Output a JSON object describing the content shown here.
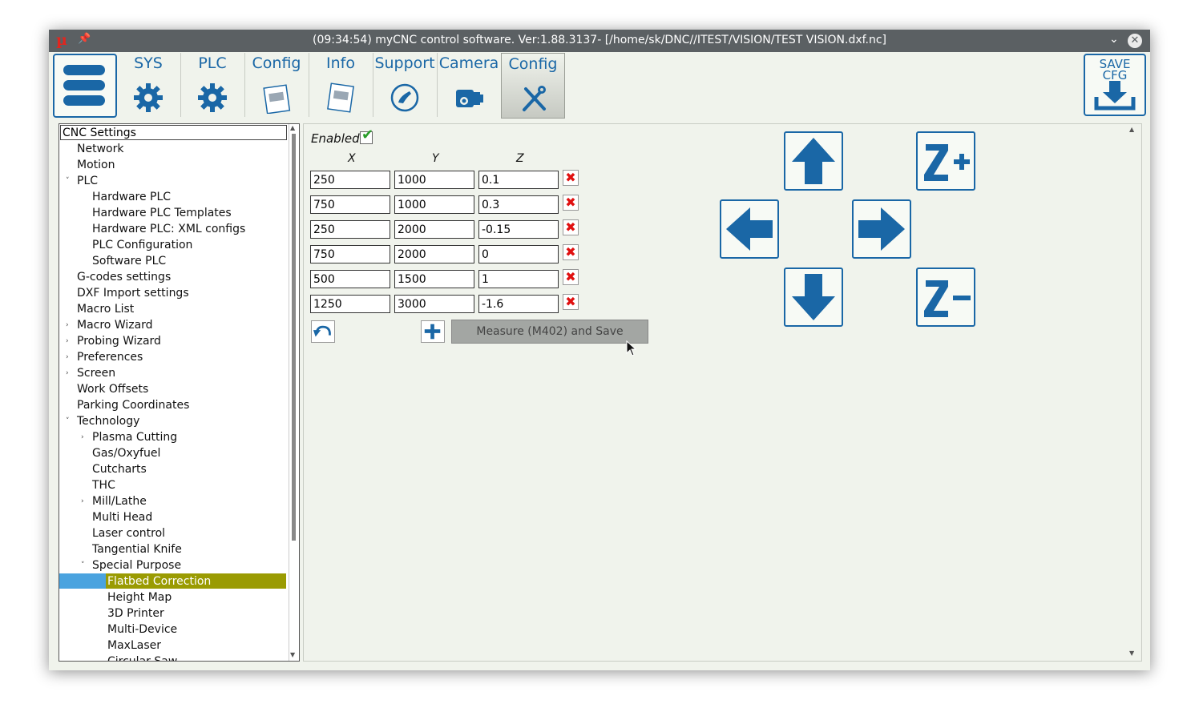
{
  "titlebar": {
    "logo": "µ",
    "pin": "📌",
    "title": "(09:34:54) myCNC control software. Ver:1.88.3137- [/home/sk/DNC//ITEST/VISION/TEST VISION.dxf.nc]",
    "minimize": "⌄",
    "close": "✕"
  },
  "tabs": [
    {
      "label": "SYS",
      "icon": "gear-icon"
    },
    {
      "label": "PLC",
      "icon": "gear-icon"
    },
    {
      "label": "Config",
      "icon": "document-icon"
    },
    {
      "label": "Info",
      "icon": "document-icon"
    },
    {
      "label": "Support",
      "icon": "phone-icon"
    },
    {
      "label": "Camera",
      "icon": "camera-icon"
    },
    {
      "label": "Config",
      "icon": "tools-icon",
      "active": true
    }
  ],
  "save_cfg": {
    "line1": "SAVE",
    "line2": "CFG"
  },
  "tree": {
    "header": "CNC Settings",
    "items": [
      {
        "label": "Network",
        "level": 1
      },
      {
        "label": "Motion",
        "level": 1
      },
      {
        "label": "PLC",
        "level": 1,
        "arrow": "˅"
      },
      {
        "label": "Hardware PLC",
        "level": 2
      },
      {
        "label": "Hardware PLC Templates",
        "level": 2
      },
      {
        "label": "Hardware PLC: XML configs",
        "level": 2
      },
      {
        "label": "PLC Configuration",
        "level": 2
      },
      {
        "label": "Software PLC",
        "level": 2
      },
      {
        "label": "G-codes settings",
        "level": 1
      },
      {
        "label": "DXF Import settings",
        "level": 1
      },
      {
        "label": "Macro List",
        "level": 1
      },
      {
        "label": "Macro Wizard",
        "level": 1,
        "arrow": "›"
      },
      {
        "label": "Probing Wizard",
        "level": 1,
        "arrow": "›"
      },
      {
        "label": "Preferences",
        "level": 1,
        "arrow": "›"
      },
      {
        "label": "Screen",
        "level": 1,
        "arrow": "›"
      },
      {
        "label": "Work Offsets",
        "level": 1
      },
      {
        "label": "Parking Coordinates",
        "level": 1
      },
      {
        "label": "Technology",
        "level": 1,
        "arrow": "˅"
      },
      {
        "label": "Plasma Cutting",
        "level": 2,
        "arrow": "›"
      },
      {
        "label": "Gas/Oxyfuel",
        "level": 2
      },
      {
        "label": "Cutcharts",
        "level": 2
      },
      {
        "label": "THC",
        "level": 2
      },
      {
        "label": "Mill/Lathe",
        "level": 2,
        "arrow": "›"
      },
      {
        "label": "Multi Head",
        "level": 2
      },
      {
        "label": "Laser control",
        "level": 2
      },
      {
        "label": "Tangential Knife",
        "level": 2
      },
      {
        "label": "Special Purpose",
        "level": 2,
        "arrow": "˅"
      },
      {
        "label": "Flatbed Correction",
        "level": 3,
        "selected": true
      },
      {
        "label": "Height Map",
        "level": 3
      },
      {
        "label": "3D Printer",
        "level": 3
      },
      {
        "label": "Multi-Device",
        "level": 3
      },
      {
        "label": "MaxLaser",
        "level": 3
      },
      {
        "label": "Circular Saw",
        "level": 3
      }
    ]
  },
  "correction": {
    "enabled_label": "Enabled",
    "enabled": true,
    "check_mark": "✔",
    "columns": [
      "X",
      "Y",
      "Z"
    ],
    "rows": [
      [
        "250",
        "1000",
        "0.1"
      ],
      [
        "750",
        "1000",
        "0.3"
      ],
      [
        "250",
        "2000",
        "-0.15"
      ],
      [
        "750",
        "2000",
        "0"
      ],
      [
        "500",
        "1500",
        "1"
      ],
      [
        "1250",
        "3000",
        "-1.6"
      ]
    ],
    "delete_glyph": "✖",
    "measure_label": "Measure (M402) and Save"
  },
  "colors": {
    "accent": "#1a67a6",
    "selection": "#9a9b02",
    "selection_left": "#4aa3df",
    "delete": "#e01010",
    "check": "#2a9d2a"
  }
}
